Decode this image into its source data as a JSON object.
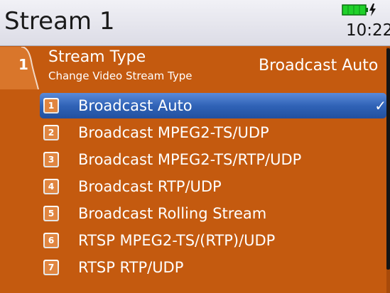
{
  "header": {
    "title": "Stream 1",
    "clock": "10:22",
    "battery_icon": "battery-charging-icon",
    "battery_color": "#1fd12a"
  },
  "menu": {
    "tab_number": "1",
    "title": "Stream Type",
    "subtitle": "Change Video Stream Type",
    "current_value": "Broadcast Auto"
  },
  "options": [
    {
      "num": "1",
      "label": "Broadcast Auto",
      "selected": true
    },
    {
      "num": "2",
      "label": "Broadcast MPEG2-TS/UDP",
      "selected": false
    },
    {
      "num": "3",
      "label": "Broadcast MPEG2-TS/RTP/UDP",
      "selected": false
    },
    {
      "num": "4",
      "label": "Broadcast RTP/UDP",
      "selected": false
    },
    {
      "num": "5",
      "label": "Broadcast Rolling Stream",
      "selected": false
    },
    {
      "num": "6",
      "label": "RTSP MPEG2-TS/(RTP)/UDP",
      "selected": false
    },
    {
      "num": "7",
      "label": "RTSP RTP/UDP",
      "selected": false
    }
  ],
  "selected_check": "✓",
  "colors": {
    "background": "#c45a0f",
    "selection": "#2f62b6",
    "header": "#e4e4ec"
  }
}
